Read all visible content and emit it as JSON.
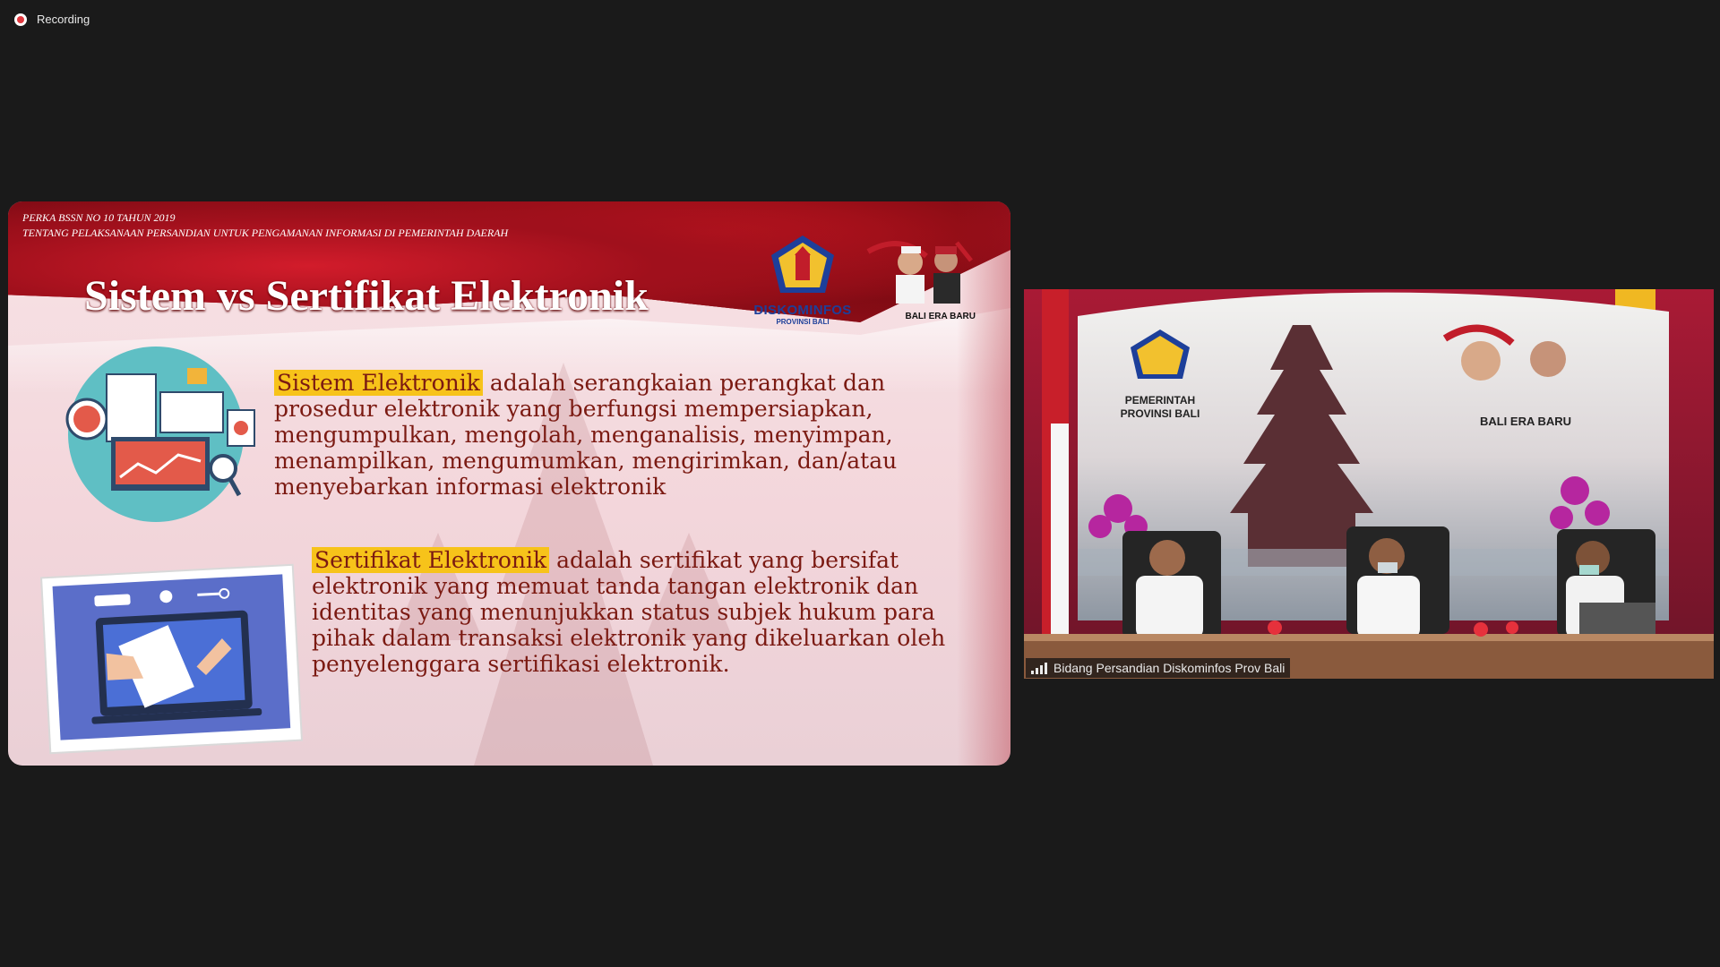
{
  "recording": {
    "label": "Recording",
    "indicator_color": "#e0383e",
    "icon": "record-icon"
  },
  "shared_screen": {
    "header_line1": "PERKA BSSN NO 10 TAHUN 2019",
    "header_line2": "TENTANG PELAKSANAAN PERSANDIAN UNTUK PENGAMANAN INFORMASI DI PEMERINTAH DAERAH",
    "title": "Sistem vs Sertifikat Elektronik",
    "logo": {
      "name": "DISKOMINFOS",
      "sub": "PROVINSI BALI"
    },
    "tagline": "BALI ERA BARU",
    "paragraph_1": {
      "term": "Sistem Elektronik",
      "definition": " adalah serangkaian perangkat dan prosedur elektronik yang berfungsi mempersiapkan, mengumpulkan, mengolah, menganalisis, menyimpan, menampilkan, mengumumkan, mengirimkan, dan/atau menyebarkan informasi elektronik"
    },
    "paragraph_2": {
      "term": "Sertifikat Elektronik",
      "definition": " adalah sertifikat yang bersifat elektronik yang memuat tanda tangan elektronik dan identitas yang menunjukkan status subjek hukum para pihak dalam transaksi elektronik yang dikeluarkan oleh  penyelenggara sertifikasi elektronik."
    },
    "colors": {
      "highlight": "#f7c31a",
      "body_text": "#7b1a12",
      "title_band": "#a0101c"
    }
  },
  "video_tile": {
    "participant_name": "Bidang Persandian Diskominfos Prov Bali",
    "background_logo_text": "PEMERINTAH PROVINSI BALI",
    "background_tagline": "BALI ERA BARU",
    "icon": "signal-strength-icon"
  }
}
